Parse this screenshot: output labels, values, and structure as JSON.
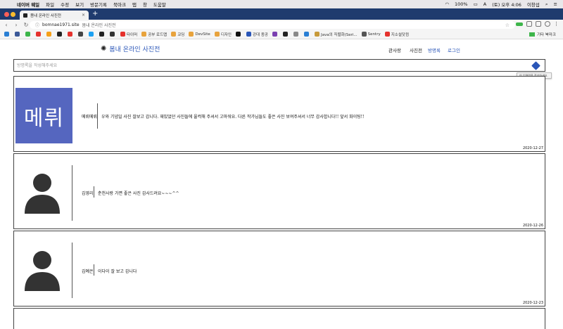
{
  "menubar": {
    "app": "네이버 웨일",
    "menus": [
      "파일",
      "수정",
      "보기",
      "방문기록",
      "북마크",
      "탭",
      "창",
      "도움말"
    ],
    "battery": "100%",
    "clock": "(토) 오후 4:06",
    "user": "이창섭"
  },
  "tab": {
    "title": "봄내 온라인 사진전",
    "close": "×",
    "new_tab": "+"
  },
  "address": {
    "url": "bomnae1971.site",
    "page_title": "봄내 온라인 사진전"
  },
  "bookmarks": [
    {
      "label": "",
      "color": "#2a7fd4"
    },
    {
      "label": "",
      "color": "#3b5998"
    },
    {
      "label": "",
      "color": "#3db54a"
    },
    {
      "label": "",
      "color": "#e5322d"
    },
    {
      "label": "",
      "color": "#f6a01a"
    },
    {
      "label": "",
      "color": "#222222"
    },
    {
      "label": "",
      "color": "#e5322d"
    },
    {
      "label": "",
      "color": "#444444"
    },
    {
      "label": "",
      "color": "#1da1f2"
    },
    {
      "label": "",
      "color": "#222222"
    },
    {
      "label": "",
      "color": "#333333"
    },
    {
      "label": "타이머",
      "color": "#e5322d"
    },
    {
      "label": "공부 로드맵",
      "color": "#e8a33d"
    },
    {
      "label": "코딩",
      "color": "#e8a33d"
    },
    {
      "label": "DevSite",
      "color": "#e8a33d"
    },
    {
      "label": "디자인",
      "color": "#e8a33d"
    },
    {
      "label": "",
      "color": "#111111"
    },
    {
      "label": "강대 종공",
      "color": "#2a56b8"
    },
    {
      "label": "",
      "color": "#7a3fb0"
    },
    {
      "label": "",
      "color": "#222222"
    },
    {
      "label": "",
      "color": "#888888"
    },
    {
      "label": "",
      "color": "#2a7fd4"
    },
    {
      "label": "Java의 직렬화(Seri...",
      "color": "#c79a3a"
    },
    {
      "label": "Sentry",
      "color": "#555555"
    },
    {
      "label": "지소설닷컴",
      "color": "#e5322d"
    }
  ],
  "bookmarks_other": "기타 북마크",
  "site": {
    "logo": "봄내 온라인 사진전",
    "nav": [
      "관사랑",
      "사진전",
      "방명록",
      "로그인"
    ],
    "search_placeholder": "방명록을 작성해주세요",
    "tooltip": "이 입력란을 작성하세요."
  },
  "entries": [
    {
      "thumb_text": "메뤼",
      "author": "메뤼메뤼",
      "message": "우와 기념일 사진 잘보고 갑니다. 재밌었던 사진들에 울컥해 주셔서 고마워요. 다른 작가님들도 좋은 사진 보여주셔서 너무 감사합니다!! 앞서 화이팅!!",
      "date": "2020-12-27"
    },
    {
      "thumb_text": "",
      "author": "김영리",
      "message": "춘천사랑 가면 좋은 사진 감사드려요~~~^^",
      "date": "2020-12-26"
    },
    {
      "thumb_text": "",
      "author": "김예은",
      "message": "이다이 잘 보고 갑니다",
      "date": "2020-12-23"
    }
  ]
}
